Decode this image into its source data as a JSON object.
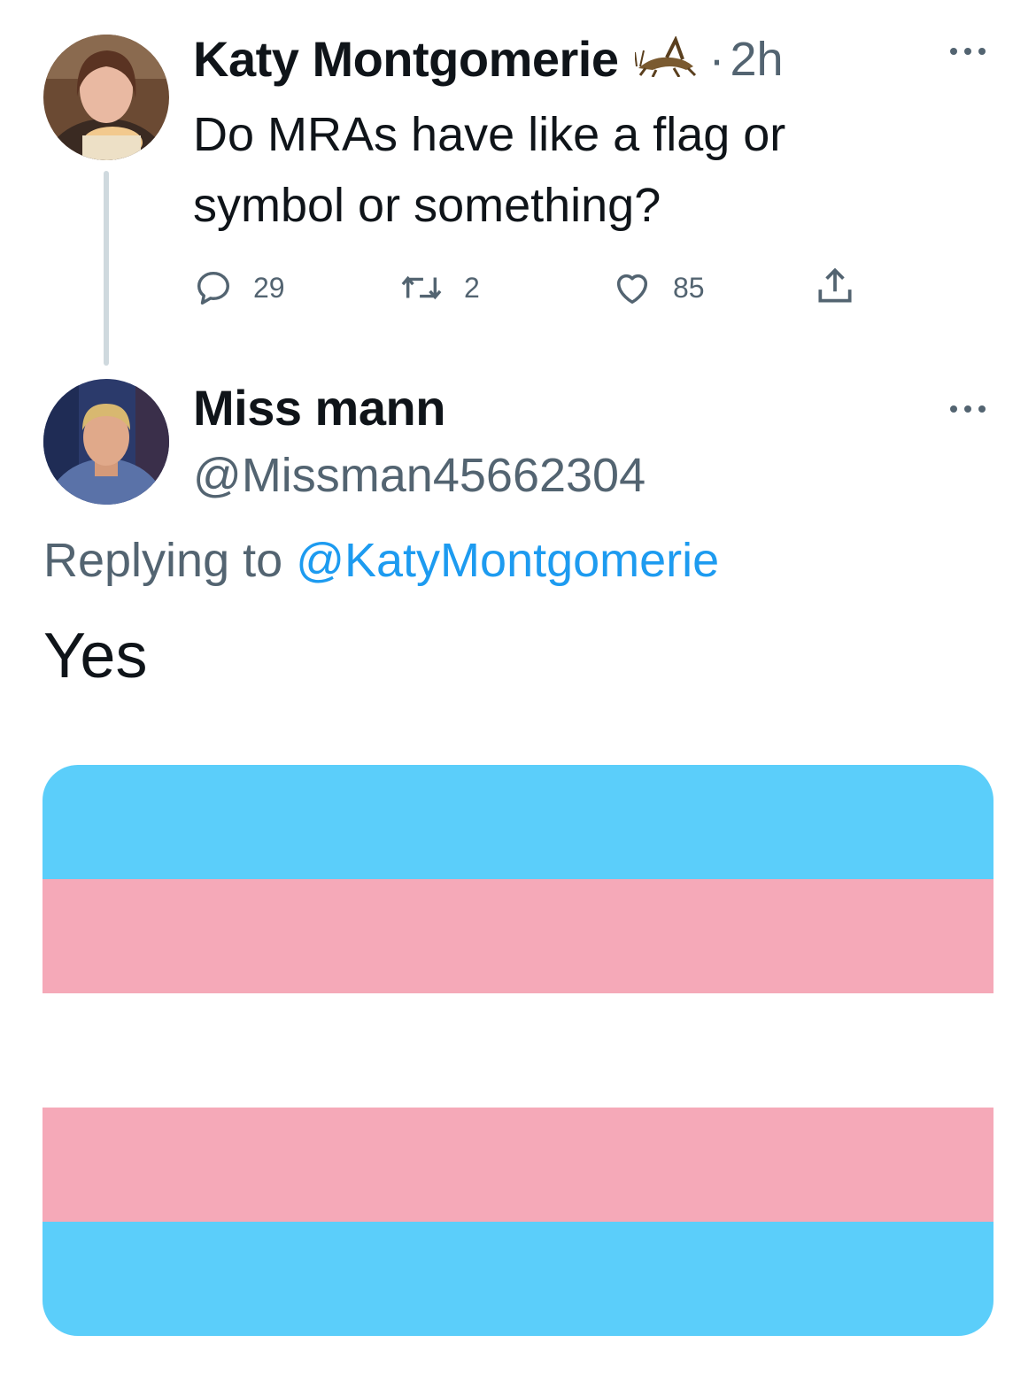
{
  "original_tweet": {
    "author_name": "Katy Montgomerie",
    "badge_icon": "cricket-icon",
    "separator": "·",
    "timestamp": "2h",
    "text": "Do MRAs have like a flag or symbol or something?",
    "more_icon": "more-icon",
    "actions": {
      "reply_count": "29",
      "retweet_count": "2",
      "like_count": "85",
      "share_icon": "share-icon"
    }
  },
  "reply_tweet": {
    "author_name": "Miss mann",
    "handle": "@Missman45662304",
    "more_icon": "more-icon",
    "replying_prefix": "Replying to",
    "replying_to": "@KatyMontgomerie",
    "text": "Yes",
    "media": {
      "type": "flag",
      "stripes": [
        "#5bcefa",
        "#f5a9b8",
        "#ffffff",
        "#f5a9b8",
        "#5bcefa"
      ]
    }
  },
  "colors": {
    "text_primary": "#0f1419",
    "text_secondary": "#536471",
    "link": "#1d9bf0",
    "thread_line": "#cfd9de"
  }
}
